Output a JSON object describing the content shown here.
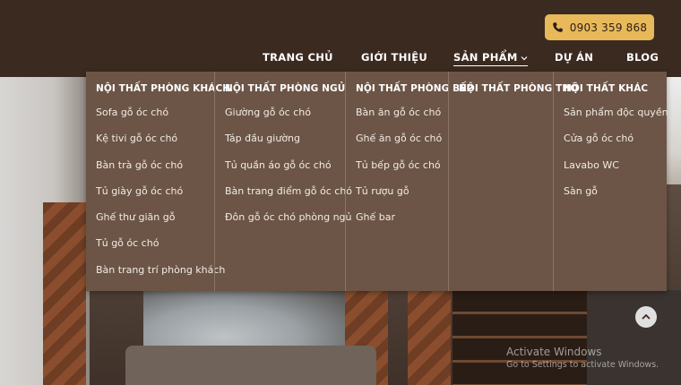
{
  "header": {
    "phone_label": "0903 359 868",
    "nav": [
      {
        "label": "TRANG CHỦ"
      },
      {
        "label": "GIỚI THIỆU"
      },
      {
        "label": "SẢN PHẨM"
      },
      {
        "label": "DỰ ÁN"
      },
      {
        "label": "BLOG"
      }
    ]
  },
  "mega_menu": {
    "columns": [
      {
        "title": "NỘI THẤT PHÒNG KHÁCH",
        "items": [
          "Sofa gỗ óc chó",
          "Kệ tivi gỗ óc chó",
          "Bàn trà gỗ óc chó",
          "Tủ giày gỗ óc chó",
          "Ghế thư giãn gỗ",
          "Tủ gỗ óc chó",
          "Bàn trang trí phòng khách"
        ]
      },
      {
        "title": "NỘI THẤT PHÒNG NGỦ",
        "items": [
          "Giường gỗ óc chó",
          "Táp đầu giường",
          "Tủ quần áo gỗ óc chó",
          "Bàn trang điểm gỗ óc chó",
          "Đôn gỗ óc chó phòng ngủ"
        ]
      },
      {
        "title": "NỘI THẤT PHÒNG BẾP",
        "items": [
          "Bàn ăn gỗ óc chó",
          "Ghế ăn gỗ óc chó",
          "Tủ bếp gỗ óc chó",
          "Tủ rượu gỗ",
          "Ghế bar"
        ]
      },
      {
        "title": "NỘI THẤT PHÒNG THỜ",
        "items": []
      },
      {
        "title": "NỘI THẤT KHÁC",
        "items": [
          "Sản phẩm độc quyền",
          "Cửa gỗ óc chó",
          "Lavabo WC",
          "Sàn gỗ"
        ]
      }
    ]
  },
  "watermark": {
    "title": "Activate Windows",
    "subtitle": "Go to Settings to activate Windows."
  },
  "colors": {
    "header_bg": "#3b2a20",
    "accent": "#e8b95a",
    "menu_bg": "#6c5546"
  }
}
